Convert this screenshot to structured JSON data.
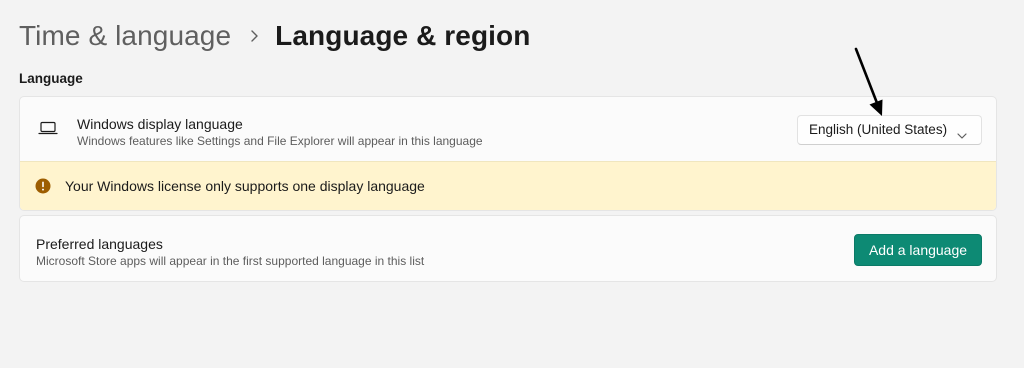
{
  "breadcrumb": {
    "parent": "Time & language",
    "current": "Language & region",
    "separator_icon": "chevron-right-icon"
  },
  "section": {
    "label": "Language"
  },
  "display_language": {
    "icon": "monitor-icon",
    "title": "Windows display language",
    "subtitle": "Windows features like Settings and File Explorer will appear in this language",
    "dropdown": {
      "selected": "English (United States)",
      "icon": "chevron-down-icon"
    },
    "warning": {
      "icon": "warning-icon",
      "text": "Your Windows license only supports one display language",
      "background": "#fff4ce",
      "icon_color": "#9d5d00"
    }
  },
  "preferred_languages": {
    "title": "Preferred languages",
    "subtitle": "Microsoft Store apps will appear in the first supported language in this list",
    "button_label": "Add a language",
    "button_color": "#0d8a74"
  },
  "annotation": {
    "icon": "arrow-annotation-icon",
    "color": "#000000"
  }
}
